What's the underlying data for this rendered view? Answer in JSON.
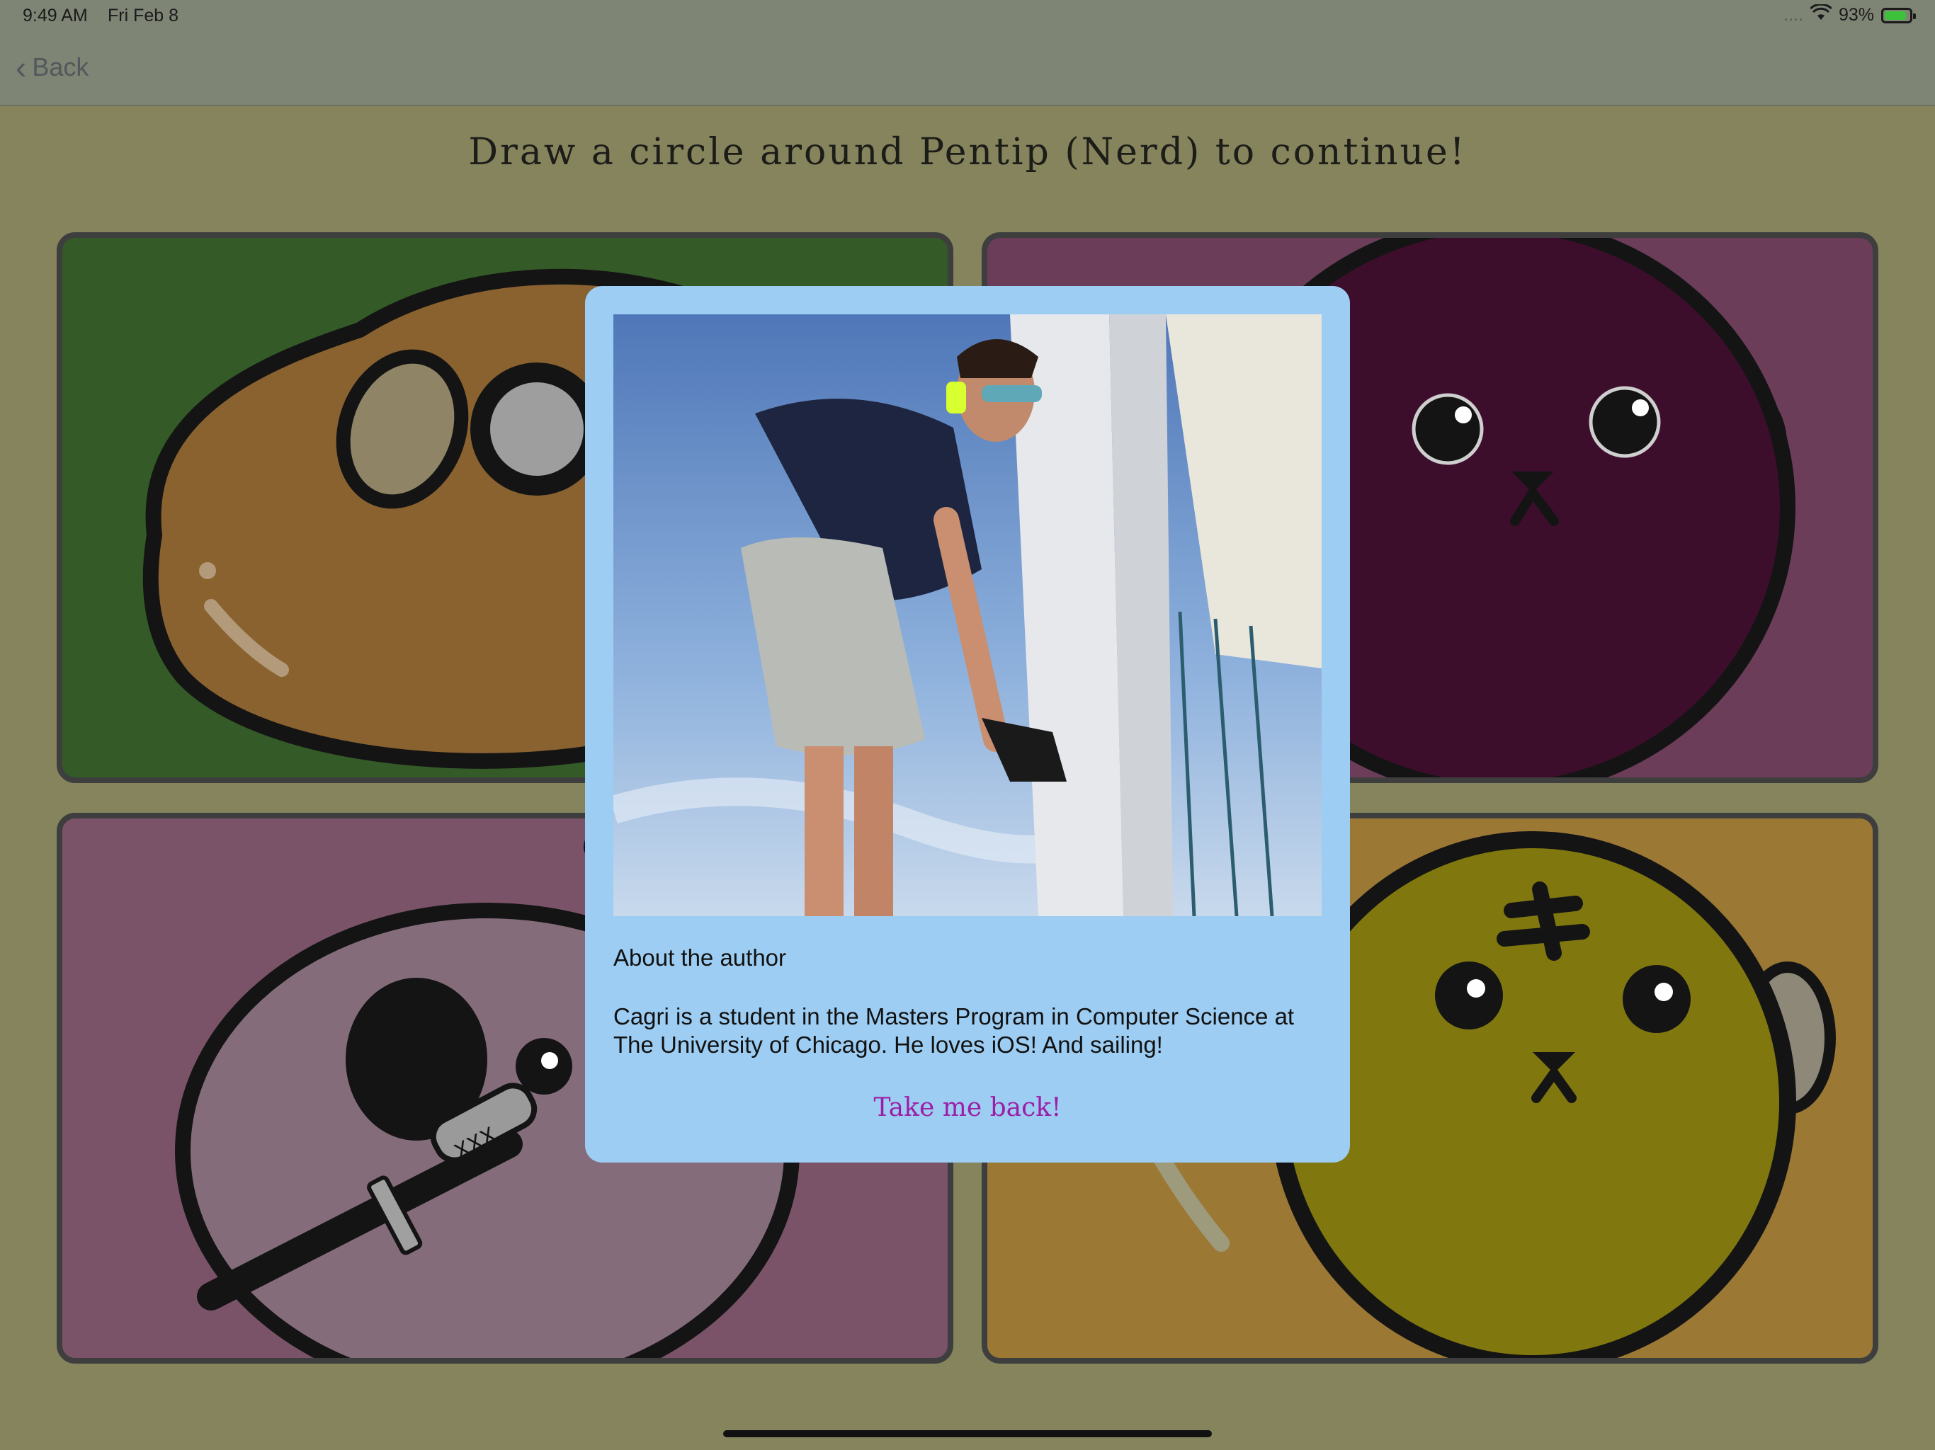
{
  "status_bar": {
    "time": "9:49 AM",
    "date": "Fri Feb 8",
    "signal": "....",
    "wifi_icon": "wifi-icon",
    "battery_percent": "93%",
    "battery_level": 0.93
  },
  "nav": {
    "back_label": "Back",
    "back_icon": "chevron-left-icon"
  },
  "instruction": "Draw a circle around Pentip (Nerd) to continue!",
  "tiles": [
    {
      "name": "brown-blob-character",
      "bg": "#345a28",
      "body": "#8a6230"
    },
    {
      "name": "dark-purple-character",
      "bg": "#6b3d59",
      "body": "#3d0e2b"
    },
    {
      "name": "pirate-character",
      "bg": "#7a5368",
      "body": "#846c7b"
    },
    {
      "name": "tiger-character",
      "bg": "#9c7835",
      "body": "#80780f"
    }
  ],
  "modal": {
    "photo_alt": "author sailing photo",
    "about_title": "About the author",
    "about_body": "Cagri is a student in the Masters Program in Computer Science at The University of Chicago. He loves iOS! And sailing!",
    "take_back_label": "Take me back!"
  },
  "colors": {
    "page_bg": "#85845d",
    "modal_bg": "#9dcdf2",
    "link": "#9b1fa6"
  }
}
